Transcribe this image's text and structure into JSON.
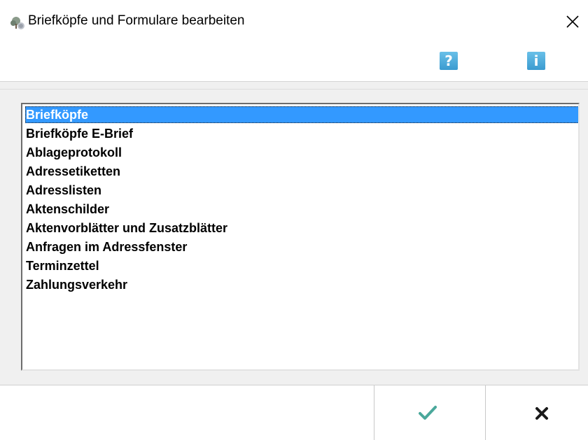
{
  "window": {
    "title": "Briefköpfe und Formulare bearbeiten",
    "app_icon": "tree-app-icon",
    "close_icon": "close-icon"
  },
  "toolbar": {
    "help_label": "?",
    "help_icon": "help-icon",
    "info_label": "i",
    "info_icon": "info-icon",
    "accent_color": "#4aa8dd"
  },
  "list": {
    "selected_index": 0,
    "selection_color": "#3399ff",
    "items": [
      "Briefköpfe",
      "Briefköpfe E-Brief",
      "Ablageprotokoll",
      "Adressetiketten",
      "Adresslisten",
      "Aktenschilder",
      "Aktenvorblätter und Zusatzblätter",
      "Anfragen im Adressfenster",
      "Terminzettel",
      "Zahlungsverkehr"
    ]
  },
  "buttons": {
    "ok_icon": "checkmark-icon",
    "ok_color": "#4aa89b",
    "cancel_icon": "cross-icon",
    "cancel_color": "#1a1a1a"
  }
}
